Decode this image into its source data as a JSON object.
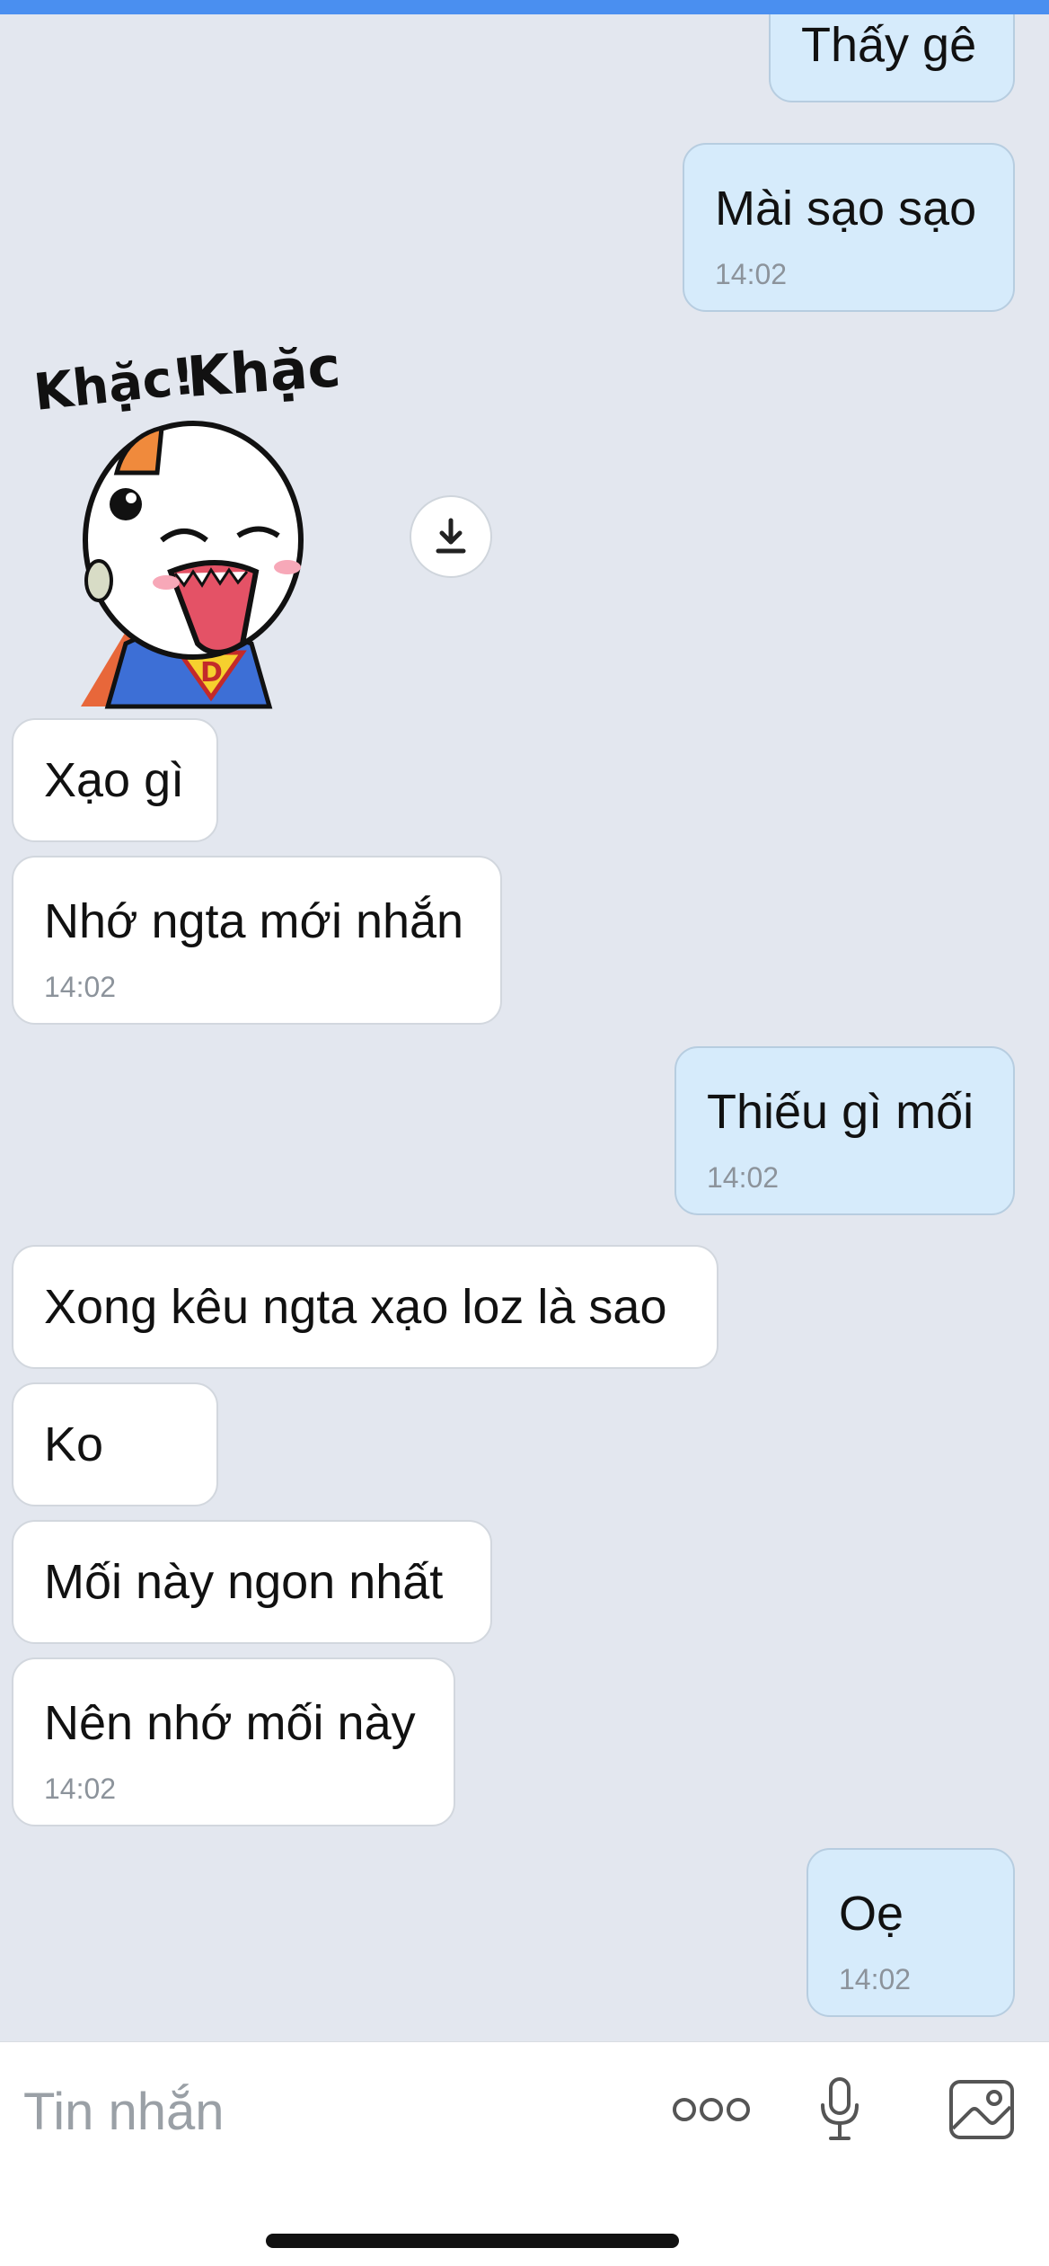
{
  "composer": {
    "placeholder": "Tin nhắn"
  },
  "messages": [
    {
      "dir": "out",
      "text": "Thấy gê",
      "time": ""
    },
    {
      "dir": "out",
      "text": "Mài sạo sạo",
      "time": "14:02"
    },
    {
      "dir": "in",
      "type": "sticker",
      "sticker_text": "Khặc! Khặc!"
    },
    {
      "dir": "in",
      "text": "Xạo gì",
      "time": ""
    },
    {
      "dir": "in",
      "text": "Nhớ ngta mới nhắn",
      "time": "14:02"
    },
    {
      "dir": "out",
      "text": "Thiếu gì mối",
      "time": "14:02"
    },
    {
      "dir": "in",
      "text": "Xong kêu ngta xạo loz là sao",
      "time": ""
    },
    {
      "dir": "in",
      "text": "Ko",
      "time": ""
    },
    {
      "dir": "in",
      "text": "Mối này ngon nhất",
      "time": ""
    },
    {
      "dir": "in",
      "text": "Nên nhớ mối này",
      "time": "14:02"
    },
    {
      "dir": "out",
      "text": "Oẹ",
      "time": "14:02"
    }
  ],
  "colors": {
    "background": "#e3e7ef",
    "incoming_bubble": "#ffffff",
    "outgoing_bubble": "#d6ebfb",
    "accent": "#4a8ff0"
  },
  "icons": [
    "download-icon",
    "more-options-icon",
    "microphone-icon",
    "image-icon"
  ]
}
